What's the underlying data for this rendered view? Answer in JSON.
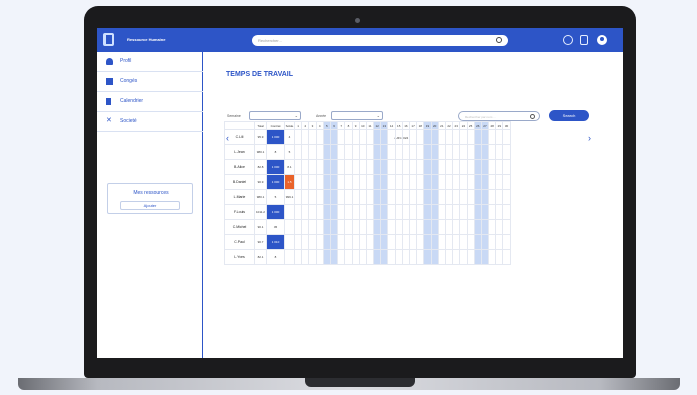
{
  "app": {
    "title": "Ressource Humaine",
    "search_placeholder": "Rechercher..."
  },
  "topbar_icons": [
    "gear-icon",
    "document-icon",
    "avatar-icon"
  ],
  "sidebar": {
    "items": [
      {
        "label": "Profil",
        "icon": "user-icon"
      },
      {
        "label": "Congés",
        "icon": "briefcase-icon"
      },
      {
        "label": "Calendrier",
        "icon": "document-icon"
      },
      {
        "label": "Societé",
        "icon": "tools-icon"
      }
    ],
    "resources": {
      "title": "Mes ressources",
      "button": "Ajouter"
    }
  },
  "main": {
    "title": "TEMPS DE TRAVAIL",
    "filters": {
      "month_label": "Semaine",
      "group_label": "Année"
    },
    "search_placeholder": "Rechercher par nom ...",
    "search_button": "Search",
    "period_label": "JUIN 2024"
  },
  "table": {
    "headers": [
      "",
      "Total",
      "Contrat",
      "Solde",
      "1",
      "2",
      "3",
      "4",
      "5",
      "6",
      "7",
      "8",
      "9",
      "10",
      "11",
      "12",
      "13",
      "14",
      "15",
      "16",
      "17",
      "18",
      "19",
      "20",
      "21",
      "22",
      "23",
      "24",
      "25",
      "26",
      "27",
      "28",
      "29",
      "30"
    ],
    "weekend_columns": [
      4,
      5,
      11,
      12,
      18,
      19,
      25,
      26
    ],
    "rows": [
      {
        "name": "C.Lili",
        "total": "95.9",
        "contrat": "1 000",
        "solde": "4",
        "contrat_style": "blue",
        "solde_style": ""
      },
      {
        "name": "L.Jean",
        "total": "980.1",
        "contrat": "8",
        "solde": "5",
        "contrat_style": "",
        "solde_style": ""
      },
      {
        "name": "B.Alice",
        "total": "82.8",
        "contrat": "1 000",
        "solde": "8.1",
        "contrat_style": "blue",
        "solde_style": ""
      },
      {
        "name": "B.Daniel",
        "total": "90.9",
        "contrat": "1 000",
        "solde": "1.5",
        "contrat_style": "blue",
        "solde_style": "orange"
      },
      {
        "name": "L.Marie",
        "total": "980.1",
        "contrat": "5",
        "solde": "999.1",
        "contrat_style": "",
        "solde_style": ""
      },
      {
        "name": "F.Louis",
        "total": "1011.2",
        "contrat": "1 000",
        "solde": "",
        "contrat_style": "blue",
        "solde_style": ""
      },
      {
        "name": "C.Michel",
        "total": "90.1",
        "contrat": "45",
        "solde": "",
        "contrat_style": "",
        "solde_style": ""
      },
      {
        "name": "C.Paul",
        "total": "90.7",
        "contrat": "1 010",
        "solde": "",
        "contrat_style": "blue",
        "solde_style": ""
      },
      {
        "name": "L.Yves",
        "total": "82.1",
        "contrat": "8",
        "solde": "",
        "contrat_style": "",
        "solde_style": ""
      }
    ]
  }
}
